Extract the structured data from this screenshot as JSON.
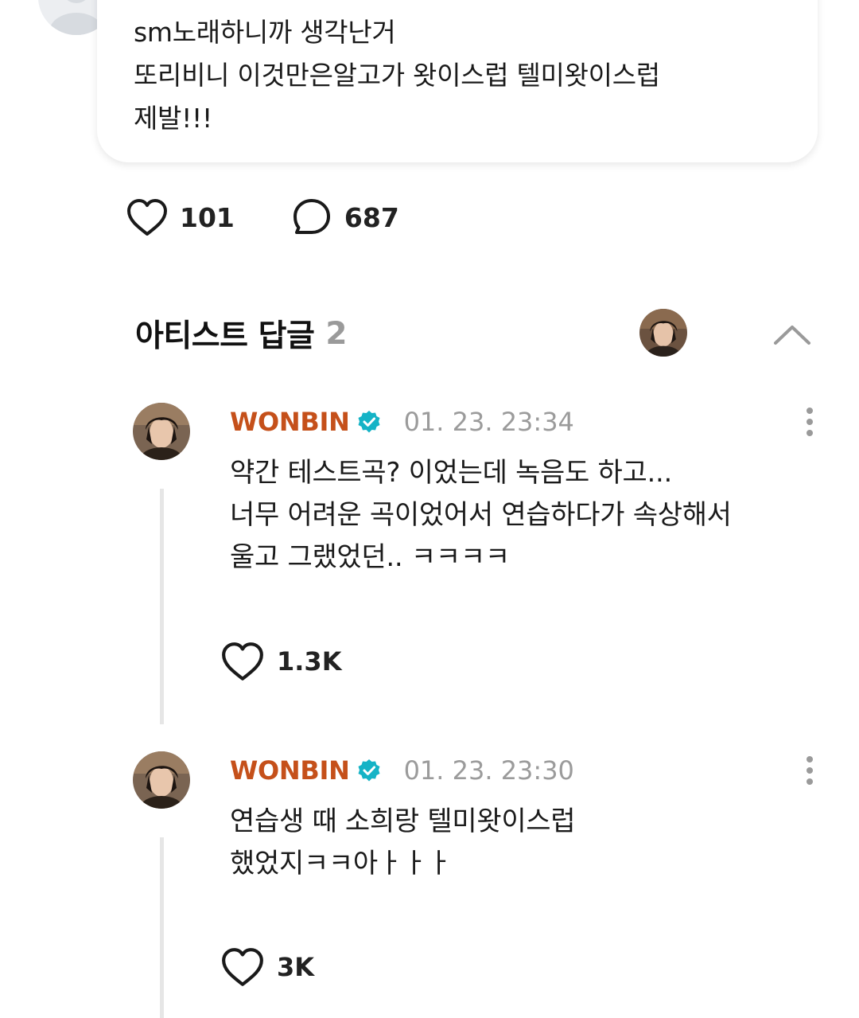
{
  "comment": {
    "text": "sm노래하니까 생각난거\n또리비니 이것만은알고가 왓이스럽 텔미왓이스럽\n제발!!!",
    "likes": "101",
    "replies": "687"
  },
  "artist_replies": {
    "title": "아티스트 답글",
    "count": "2"
  },
  "replies": [
    {
      "name": "WONBIN",
      "date": "01. 23. 23:34",
      "text": "약간 테스트곡? 이었는데 녹음도 하고...\n너무 어려운 곡이었어서 연습하다가 속상해서\n울고 그랬었던.. ㅋㅋㅋㅋ",
      "likes": "1.3K"
    },
    {
      "name": "WONBIN",
      "date": "01. 23. 23:30",
      "text": "연습생 때 소희랑 텔미왓이스럽\n했었지ㅋㅋ아ㅏㅏㅏ",
      "likes": "3K"
    }
  ],
  "colors": {
    "artist_name": "#c5501a",
    "verified_badge": "#15b3c6",
    "muted": "#9b9b9b"
  },
  "icons": {
    "like": "heart-outline-icon",
    "comment": "speech-bubble-icon",
    "verified": "verified-badge-icon",
    "more": "vertical-dots-icon",
    "collapse": "chevron-up-icon"
  }
}
